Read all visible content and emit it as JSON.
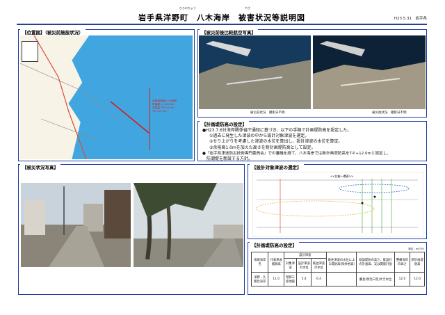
{
  "header": {
    "title": "岩手県洋野町　八木海岸　被害状況等説明図",
    "ruby_hirono": "ひろのちょう",
    "ruby_yagi": "やぎ",
    "date_org": "H23.5.31　岩手県"
  },
  "location_panel": {
    "label": "【位置図】（被災前施設状況）",
    "map_annotation": [
      "未満漁港堤(八木海岸)",
      "防潮堤 L=410.0m",
      "天端高 TP+12.0m",
      "T.P.=12.0m"
    ]
  },
  "aerial_panel": {
    "label": "【被災前後比較航空写真】",
    "before_caption": "被災前状況　撮影日不明",
    "after_caption": "被災後状況　撮影日不明"
  },
  "plan_panel": {
    "label": "【計画堤防高の設定】",
    "lines": [
      "●H23.7.6付海岸関係省庁通知に基づき、以下の手順で計画堤防高を設定した。",
      "①過去に発生した津波の中から設計対象津波を選定。",
      "②せり上がりを考慮した津波の水位を算出し、設計津波の水位を算定。",
      "③余裕高1.0mを加えた高さを新計画堤防高として設定。",
      "●『岩手県津波防災技術専門委員会』での審議を経て、八木海岸では新計画堤防高をT.P.+12.0mと設定し、",
      "防潮堤を新設する方針。"
    ]
  },
  "damage_panel": {
    "label": "【被災状況写真】"
  },
  "chart_panel": {
    "label": "【設計対象津波の選定】",
    "legend_title": "<<比較一欄表>>"
  },
  "table_panel": {
    "label": "【計画堤防高の設定】",
    "unit": "単位：m(T.P.)",
    "headers": [
      "地域海岸名",
      "代表津波痕跡高",
      "設計津波",
      "",
      "",
      "既往津波の水位による堤防高(除余裕高)",
      "既設堤防の高さ、既設計の計画高、又は開発計画",
      "整備海岸の高さ",
      "新計画堤防高"
    ],
    "subheaders": [
      "",
      "",
      "対象津波",
      "設計津波の水位",
      "既往津波の水位",
      "",
      "",
      "",
      ""
    ],
    "row": [
      "洋野・久慈北海岸",
      "11.0",
      "昭和三陸地震",
      "5.4",
      "6.4",
      "",
      "慶長(明治三陸)大き水位",
      "12.0",
      "12.0"
    ]
  },
  "colors": {
    "accent": "#1e3c9c",
    "title_rule": "#2a3f8f",
    "sea": "#41a6df",
    "red": "#e0161b"
  }
}
